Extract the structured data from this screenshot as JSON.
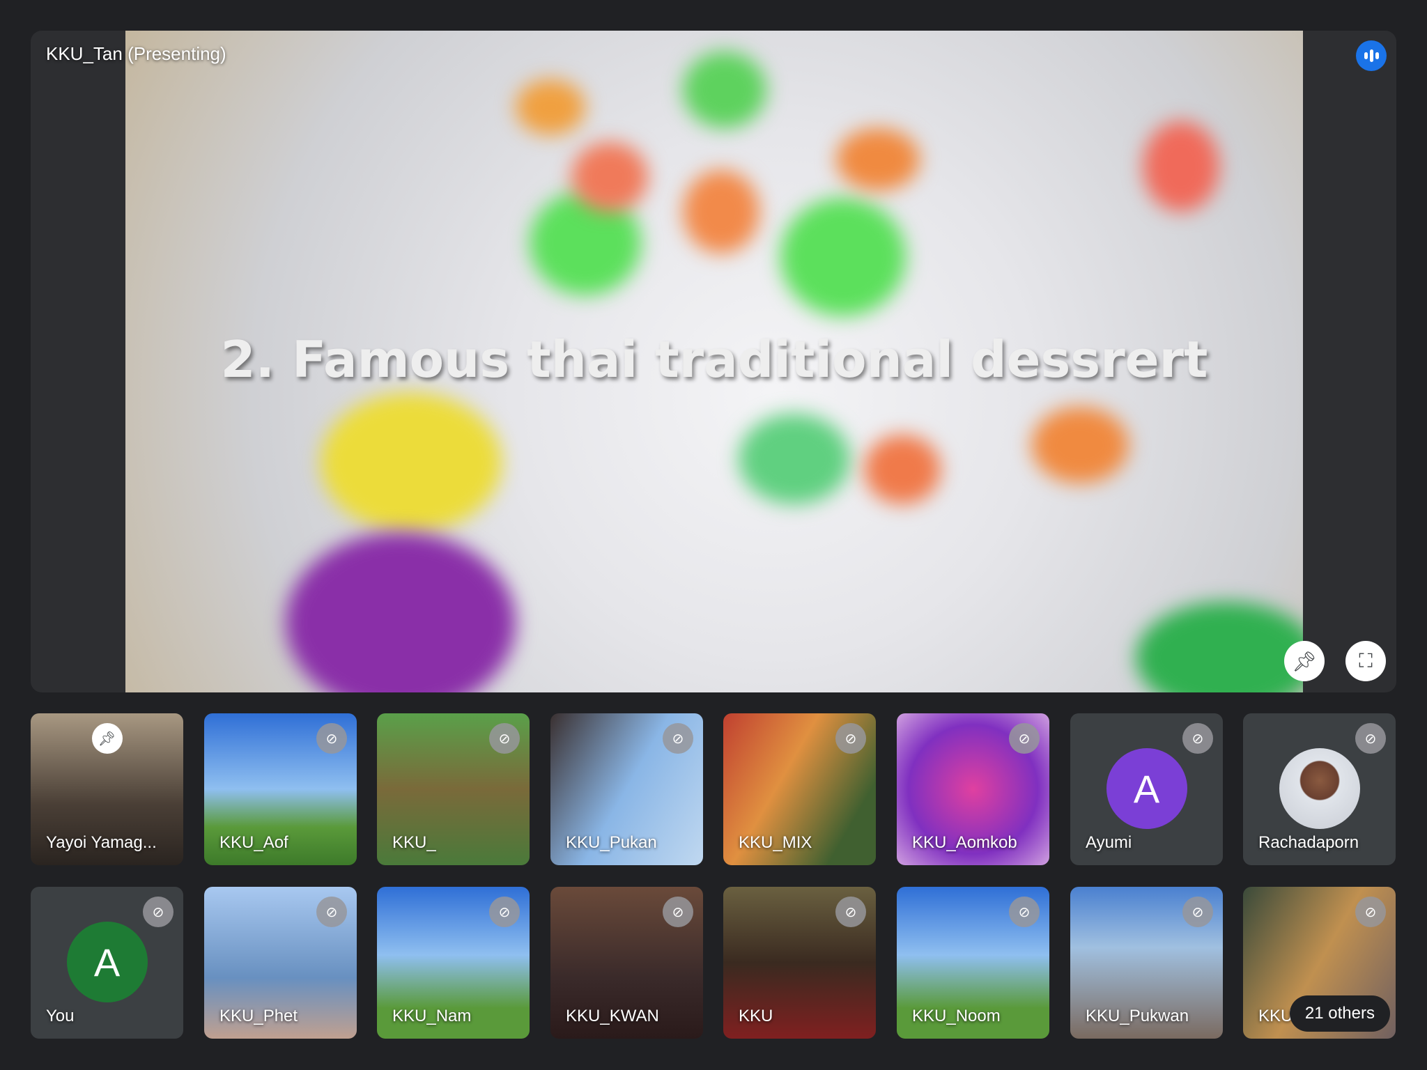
{
  "stage": {
    "presenter": "KKU_Tan (Presenting)",
    "slide_title": "2. Famous thai traditional dessrert",
    "icons": [
      "speaking-indicator-icon",
      "unpin-icon",
      "fullscreen-icon"
    ],
    "accent": "#1a73e8"
  },
  "tiles": [
    {
      "name": "Yayoi Yamag...",
      "bg": "linear-gradient(180deg,#a89882,#4a3f36 60%,#2a2420)",
      "pinned": true
    },
    {
      "name": "KKU_Aof",
      "bg": "linear-gradient(180deg,#2f6fd6,#8fbff0 50%,#5a9a3a 75%,#3d7a2a)"
    },
    {
      "name": "KKU_",
      "bg": "linear-gradient(180deg,#5aa04a,#7a6a3a 50%,#4a7a3a)"
    },
    {
      "name": "KKU_Pukan",
      "bg": "linear-gradient(120deg,#3a3030,#8ab6e6 50%,#c0d8f0)"
    },
    {
      "name": "KKU_MIX",
      "bg": "linear-gradient(120deg,#c04030,#e09040 40%,#406030 80%)"
    },
    {
      "name": "KKU_Aomkob",
      "bg": "radial-gradient(circle,#e040a0,#8030c0 60%,#d0a0e0)"
    },
    {
      "name": "Ayumi",
      "avatar": "A",
      "avatar_color": "#7b3fd6"
    },
    {
      "name": "Rachadaporn",
      "photo": true
    },
    {
      "name": "You",
      "avatar": "A",
      "avatar_color": "#1e7b34"
    },
    {
      "name": "KKU_Phet",
      "bg": "linear-gradient(180deg,#a8c8f0,#6890c0 60%,#c0a090)"
    },
    {
      "name": "KKU_Nam",
      "bg": "linear-gradient(180deg,#2f6fd6,#8fbff0 45%,#5a9a3a 80%)"
    },
    {
      "name": "KKU_KWAN",
      "bg": "linear-gradient(180deg,#6a4a3a,#3a2a2a 60%,#2a1a1a)"
    },
    {
      "name": "KKU",
      "bg": "linear-gradient(180deg,#6a6040,#3a2a20 50%,#802020)"
    },
    {
      "name": "KKU_Noom",
      "bg": "linear-gradient(180deg,#2f6fd6,#8fbff0 45%,#5a9a3a 80%)"
    },
    {
      "name": "KKU_Pukwan",
      "bg": "linear-gradient(180deg,#4a80d0,#a0c0e0 40%,#7a6a60)"
    },
    {
      "name": "KKU",
      "bg": "linear-gradient(120deg,#3a4a3a,#c09050 50%,#706060)",
      "others": "21 others"
    }
  ]
}
